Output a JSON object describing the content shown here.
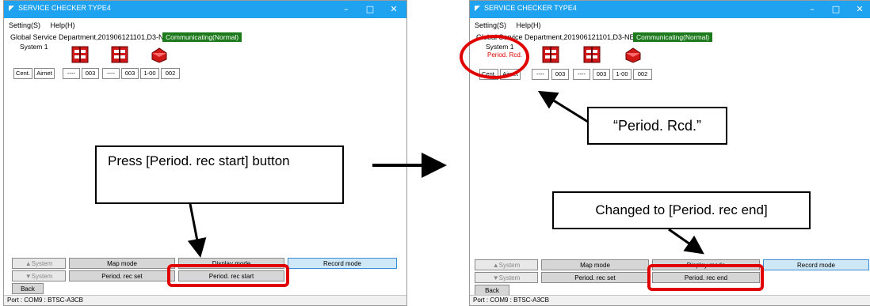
{
  "window": {
    "title": "SERVICE CHECKER TYPE4",
    "minimize": "–",
    "maximize": "□",
    "close": "✕"
  },
  "menu": {
    "setting": "Setting(S)",
    "help": "Help(H)"
  },
  "dept": "Global Service Department,201906121101,D3-NET",
  "status": "Communicating(Normal)",
  "system_label": "System 1",
  "period_label": "Period. Rcd.",
  "boxes": [
    "Cent.",
    "Airnet",
    "----",
    "003",
    "----",
    "003",
    "1-00",
    "002"
  ],
  "buttons": {
    "system_up": "▲System",
    "system_down": "▼System",
    "map_mode": "Map mode",
    "display_mode": "Display mode",
    "record_mode": "Record mode",
    "period_rec_set": "Period. rec set",
    "period_rec_start": "Period. rec start",
    "period_rec_end": "Period. rec end",
    "back": "Back"
  },
  "port": "Port : COM9 : BTSC-A3CB",
  "callouts": {
    "press": "Press [Period. rec start] button",
    "period_rcd": "“Period. Rcd.”",
    "changed": "Changed to [Period. rec end]"
  },
  "icons": {
    "app": "app-logo-icon",
    "unit": "red-unit-icon",
    "arrow": "arrow-right-icon"
  },
  "colors": {
    "titlebar": "#1fa3f0",
    "status": "#1c7a1c",
    "highlight": "#e00000",
    "record_mode": "#cfe8f7"
  }
}
